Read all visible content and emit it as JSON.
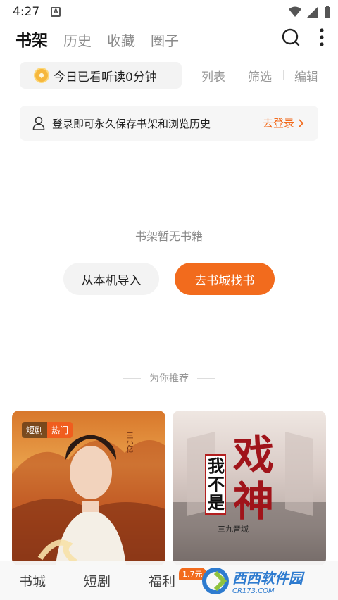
{
  "status_bar": {
    "time": "4:27",
    "app_letter": "A"
  },
  "top_tabs": [
    {
      "label": "书架",
      "active": true
    },
    {
      "label": "历史"
    },
    {
      "label": "收藏"
    },
    {
      "label": "圈子"
    }
  ],
  "icons": {
    "search": "search-icon",
    "more": "more-vertical-icon",
    "coin": "coin-icon",
    "user": "user-icon"
  },
  "reading": {
    "text": "今日已看听读0分钟"
  },
  "reading_actions": [
    "列表",
    "筛选",
    "编辑"
  ],
  "login_banner": {
    "text": "登录即可永久保存书架和浏览历史",
    "cta": "去登录"
  },
  "empty": {
    "text": "书架暂无书籍",
    "import_button": "从本机导入",
    "store_button": "去书城找书"
  },
  "recommend": {
    "label": "为你推荐"
  },
  "cards": [
    {
      "tags": [
        "短剧",
        "热门"
      ],
      "cover_text": "王小亿"
    },
    {
      "title_a": "我不是",
      "title_b": "戏神",
      "author": "三九音域"
    }
  ],
  "bottom_nav": [
    "书城",
    "短剧",
    "福利"
  ],
  "nav_badge": "1.7元",
  "watermark": {
    "name": "西西软件园",
    "domain": "CR173.COM"
  },
  "colors": {
    "accent": "#f26b1d",
    "coin": "#f6b73c"
  }
}
